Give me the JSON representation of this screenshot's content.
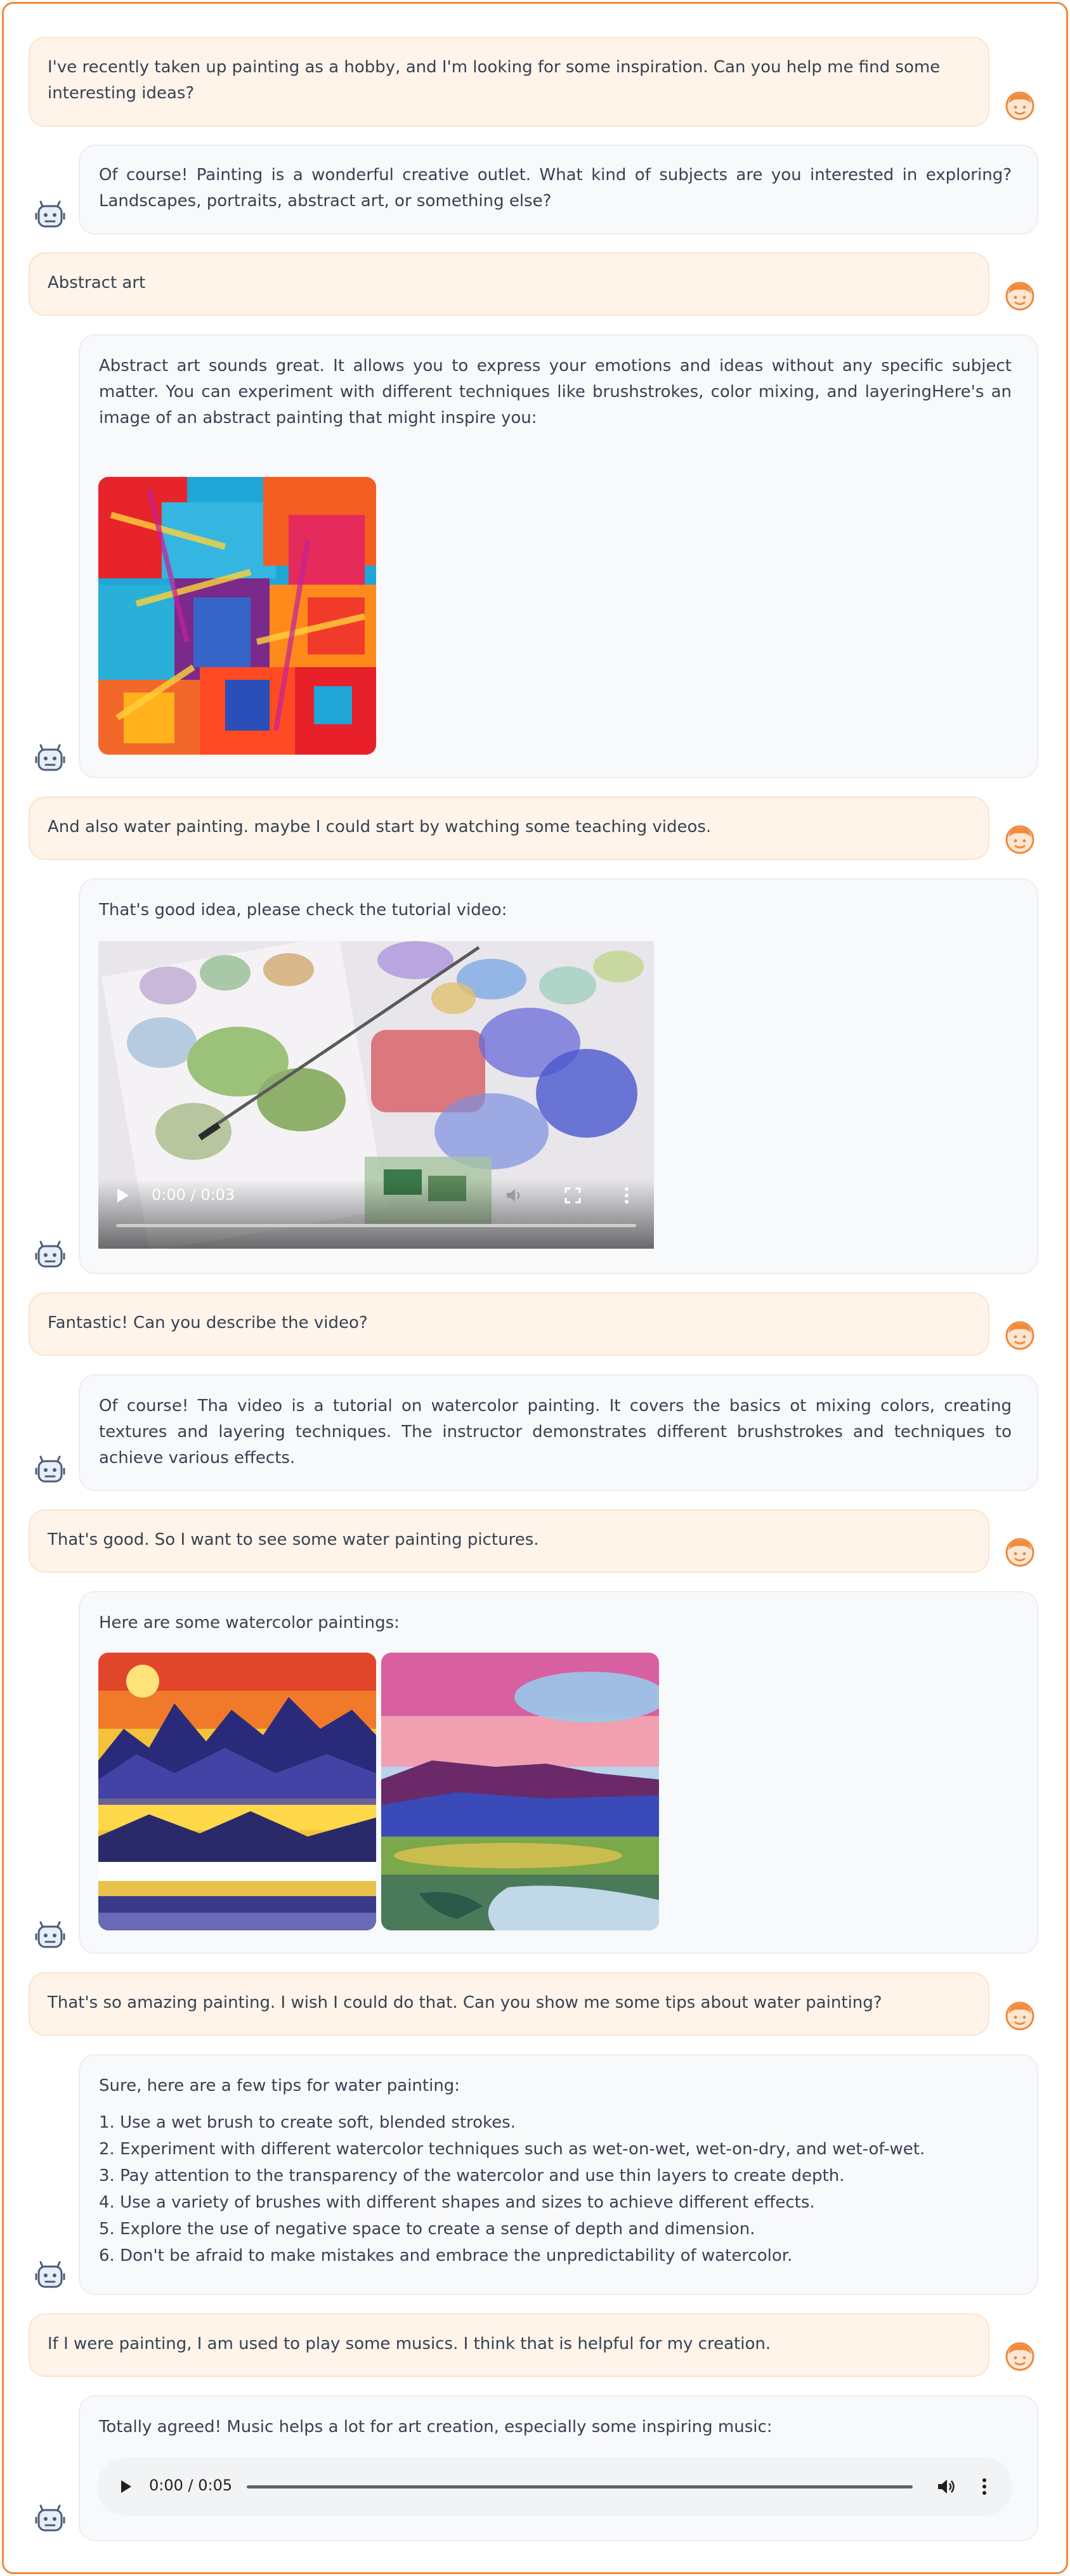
{
  "messages": {
    "m1_user": "I've recently taken up painting as a hobby, and I'm looking for some inspiration. Can you help me find some interesting ideas?",
    "m2_bot": "Of course! Painting is a wonderful creative outlet. What kind of subjects are you interested in exploring? Landscapes, portraits, abstract art, or something else?",
    "m3_user": "Abstract art",
    "m4_bot": "Abstract art sounds great. It allows you to express your emotions and ideas without any specific subject matter. You can experiment with different techniques like brushstrokes, color mixing, and layeringHere's an image of an abstract painting that might inspire you:",
    "m5_user": "And also water painting. maybe I could start by watching some teaching videos.",
    "m6_bot": "That's good idea, please check the tutorial video:",
    "m7_user": "Fantastic! Can you describe the video?",
    "m8_bot": "Of course! Tha video is a tutorial on watercolor painting. It covers the basics ot mixing colors, creating textures and layering techniques. The instructor demonstrates different brushstrokes and techniques to achieve various effects.",
    "m9_user": "That's good. So I want to see some water painting pictures.",
    "m10_bot": "Here are some watercolor paintings:",
    "m11_user": "That's so amazing painting. I wish I could do that. Can you show me some tips about water painting?",
    "m12_bot_intro": "Sure, here are a few tips for water painting:",
    "m12_tips": [
      "1. Use a wet brush to create soft, blended strokes.",
      "2. Experiment with different watercolor techniques such as wet-on-wet, wet-on-dry, and wet-of-wet.",
      "3. Pay attention to the transparency of the watercolor and use thin layers to create depth.",
      "4. Use a variety of brushes with different shapes and sizes to achieve different effects.",
      "5. Explore the use of negative space to create a sense of depth and dimension.",
      "6. Don't be afraid to make mistakes and embrace the unpredictability of watercolor."
    ],
    "m13_user": "If I were painting, I am used to play some musics. I think that is helpful for my creation.",
    "m14_bot": "Totally agreed! Music helps a lot for art creation, especially some inspiring music:"
  },
  "video": {
    "time": "0:00 / 0:03"
  },
  "audio": {
    "time": "0:00 / 0:05"
  },
  "icons": {
    "user_avatar": "user-face-icon",
    "bot_avatar": "robot-face-icon",
    "play": "play-icon",
    "fullscreen": "fullscreen-icon",
    "volume": "volume-icon",
    "more": "more-vertical-icon"
  },
  "colors": {
    "accent": "#f08a3c",
    "user_bubble": "#fff4ea",
    "bot_bubble": "#f8f9fb",
    "bot_icon": "#4a5d7a"
  }
}
